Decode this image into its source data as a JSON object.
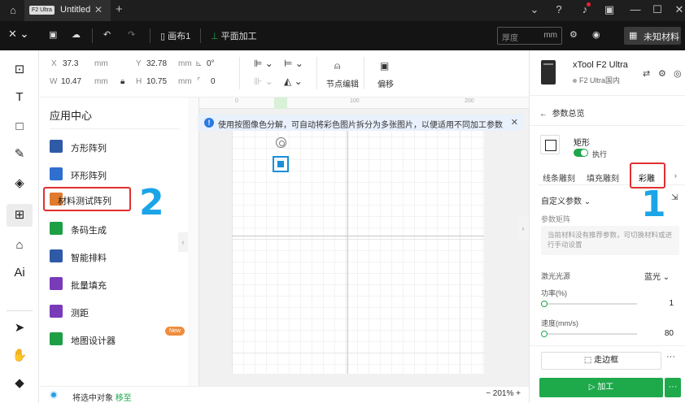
{
  "titlebar": {
    "tab_badge": "F2 Ultra",
    "tab_title": "Untitled",
    "tab_close": "✕",
    "new_tab": "+"
  },
  "toolbar": {
    "logo": "✕ ⌄",
    "canvas_label": "画布1",
    "mode_label": "平面加工",
    "thickness_placeholder": "厚度",
    "thickness_unit": "mm",
    "material_label": "未知材料"
  },
  "props": {
    "x_label": "X",
    "x_value": "37.3",
    "x_unit": "mm",
    "y_label": "Y",
    "y_value": "32.78",
    "y_unit": "mm",
    "angle_value": "0°",
    "w_label": "W",
    "w_value": "10.47",
    "w_unit": "mm",
    "h_label": "H",
    "h_value": "10.75",
    "h_unit": "mm",
    "corner_value": "0",
    "node_edit": "节点编辑",
    "offset": "偏移"
  },
  "appcenter": {
    "title": "应用中心",
    "items": [
      {
        "label": "方形阵列",
        "color": "#2f5aa8"
      },
      {
        "label": "环形阵列",
        "color": "#2f6fd0"
      },
      {
        "label": "材料测试阵列",
        "color": "#e07a2e"
      },
      {
        "label": "条码生成",
        "color": "#1e9e45"
      },
      {
        "label": "智能排料",
        "color": "#2f5aa8"
      },
      {
        "label": "批量填充",
        "color": "#7a3bb8"
      },
      {
        "label": "测距",
        "color": "#7a3bb8"
      },
      {
        "label": "地图设计器",
        "color": "#1e9e45"
      }
    ],
    "new_badge": "New",
    "annotation_2": "2"
  },
  "canvas": {
    "ruler_marks": [
      "0",
      "100",
      "200"
    ],
    "banner_text": "使用按图像色分解，可自动将彩色图片拆分为多张图片，以便适用不同加工参数",
    "banner_close": "✕"
  },
  "status": {
    "message": "将选中对象",
    "link": "移至",
    "zoom": "−  201%  +"
  },
  "device": {
    "name": "xTool F2 Ultra",
    "connection": "F2 Ultra国内"
  },
  "panel": {
    "back_label": "参数总览",
    "shape_name": "矩形",
    "toggle_label": "执行",
    "tabs": [
      "线条雕刻",
      "填充雕刻",
      "彩雕"
    ],
    "annotation_1": "1",
    "custom_params": "自定义参数",
    "params_label": "参数矩阵",
    "hint": "当前材料没有推荐参数，可切换材料或进行手动设置",
    "laser_source_label": "激光光源",
    "laser_source_value": "蓝光",
    "power_label": "功率(%)",
    "power_value": "1",
    "speed_label": "速度(mm/s)",
    "speed_value": "80",
    "frame_button": "走边框",
    "go_button": "▷ 加工",
    "more": "···"
  },
  "colors": {
    "accent_green": "#1ea94b",
    "highlight_red": "#e03030",
    "annotation_blue": "#1aa5e8"
  }
}
